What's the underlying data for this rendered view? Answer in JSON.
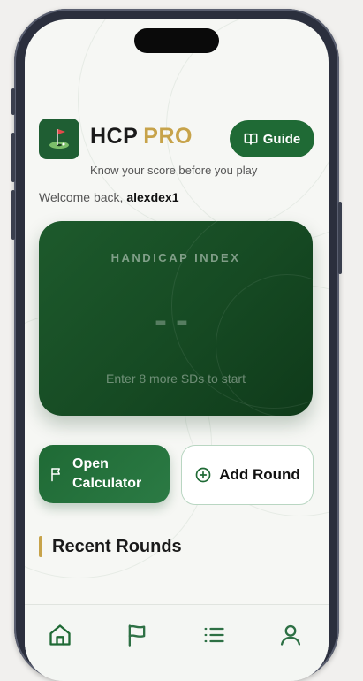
{
  "app": {
    "brand_main": "HCP",
    "brand_accent": "PRO",
    "tagline": "Know your score before you play",
    "guide_label": "Guide"
  },
  "welcome": {
    "prefix": "Welcome back,",
    "username": "alexdex1"
  },
  "handicap": {
    "label": "HANDICAP INDEX",
    "value": "--",
    "hint": "Enter 8 more SDs to start"
  },
  "actions": {
    "open_calculator": "Open Calculator",
    "add_round": "Add Round"
  },
  "recent_rounds": {
    "title": "Recent Rounds"
  },
  "tabbar": {
    "items": [
      {
        "icon": "home-icon",
        "active": true
      },
      {
        "icon": "flag-icon",
        "active": false
      },
      {
        "icon": "list-icon",
        "active": false
      },
      {
        "icon": "user-icon",
        "active": false
      }
    ]
  },
  "colors": {
    "primary": "#1f6a35",
    "accent": "#c7a34a",
    "card_dark": "#164a23",
    "background": "#f6f7f4"
  }
}
